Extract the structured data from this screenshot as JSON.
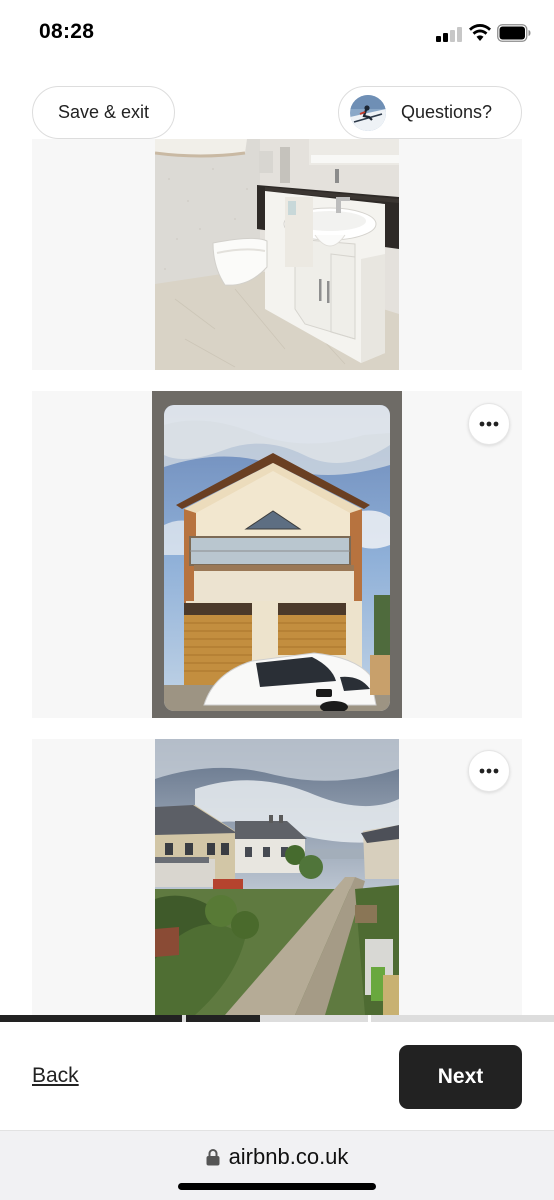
{
  "status_bar": {
    "time": "08:28",
    "icons": [
      "signal-icon",
      "wifi-icon",
      "battery-icon"
    ]
  },
  "header": {
    "save_exit_label": "Save & exit",
    "questions_label": "Questions?",
    "avatar_icon": "skier-avatar"
  },
  "photos": [
    {
      "subject": "bathroom-photo",
      "has_menu": false
    },
    {
      "subject": "house-garage-photo",
      "has_menu": true,
      "menu_icon": "more-options-icon"
    },
    {
      "subject": "street-view-photo",
      "has_menu": true,
      "menu_icon": "more-options-icon"
    }
  ],
  "progress": {
    "segments": 3,
    "completed_fraction": 0.47
  },
  "footer": {
    "back_label": "Back",
    "next_label": "Next"
  },
  "browser": {
    "url": "airbnb.co.uk"
  },
  "colors": {
    "text": "#222222",
    "next_bg": "#222222",
    "card_bg": "#f7f7f7",
    "border": "#dddddd"
  }
}
